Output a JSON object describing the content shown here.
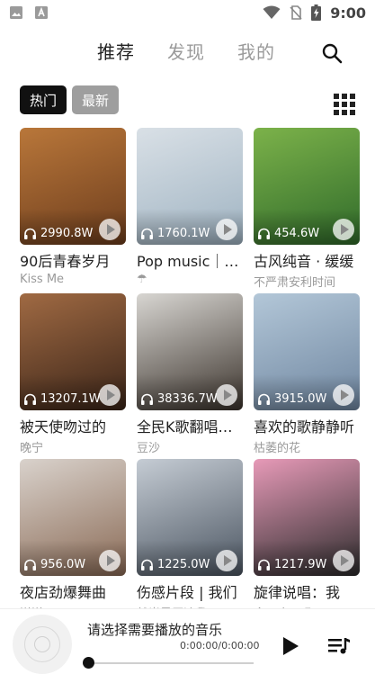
{
  "status_bar": {
    "time": "9:00"
  },
  "nav": {
    "tabs": [
      {
        "label": "推荐",
        "active": true
      },
      {
        "label": "发现",
        "active": false
      },
      {
        "label": "我的",
        "active": false
      }
    ]
  },
  "filters": {
    "hot": "热门",
    "new": "最新"
  },
  "cards": [
    {
      "plays": "2990.8W",
      "title": "90后青春岁月",
      "sub": "Kiss Me",
      "colors": [
        "#b9773a",
        "#6d3d1d"
      ]
    },
    {
      "plays": "1760.1W",
      "title": "Pop music｜欧美",
      "sub": "☂",
      "colors": [
        "#d9e0e6",
        "#9fb3c2"
      ]
    },
    {
      "plays": "454.6W",
      "title": "古风纯音 · 缓缓",
      "sub": "不严肃安利时间",
      "colors": [
        "#7cb24a",
        "#2f6a2a"
      ]
    },
    {
      "plays": "13207.1W",
      "title": "被天使吻过的",
      "sub": "晚宁",
      "colors": [
        "#a06a43",
        "#3a2418"
      ]
    },
    {
      "plays": "38336.7W",
      "title": "全民K歌翻唱精选",
      "sub": "豆沙",
      "colors": [
        "#d8d6d2",
        "#3b332c"
      ]
    },
    {
      "plays": "3915.0W",
      "title": "喜欢的歌静静听",
      "sub": "枯萎的花",
      "colors": [
        "#b3c7d8",
        "#6f86a0"
      ]
    },
    {
      "plays": "956.0W",
      "title": "夜店劲爆舞曲",
      "sub": "洋洋",
      "colors": [
        "#d9d2cc",
        "#8a6a55"
      ]
    },
    {
      "plays": "1225.0W",
      "title": "伤感片段 | 我们",
      "sub": "就当是原谅我了",
      "colors": [
        "#c5ccd4",
        "#4b5561"
      ]
    },
    {
      "plays": "1217.9W",
      "title": "旋律说唱：我",
      "sub": "今天吃了吗",
      "colors": [
        "#e79ab8",
        "#2b2b2b"
      ]
    }
  ],
  "player": {
    "title": "请选择需要播放的音乐",
    "time": "0:00:00/0:00:00",
    "progress": 0
  }
}
